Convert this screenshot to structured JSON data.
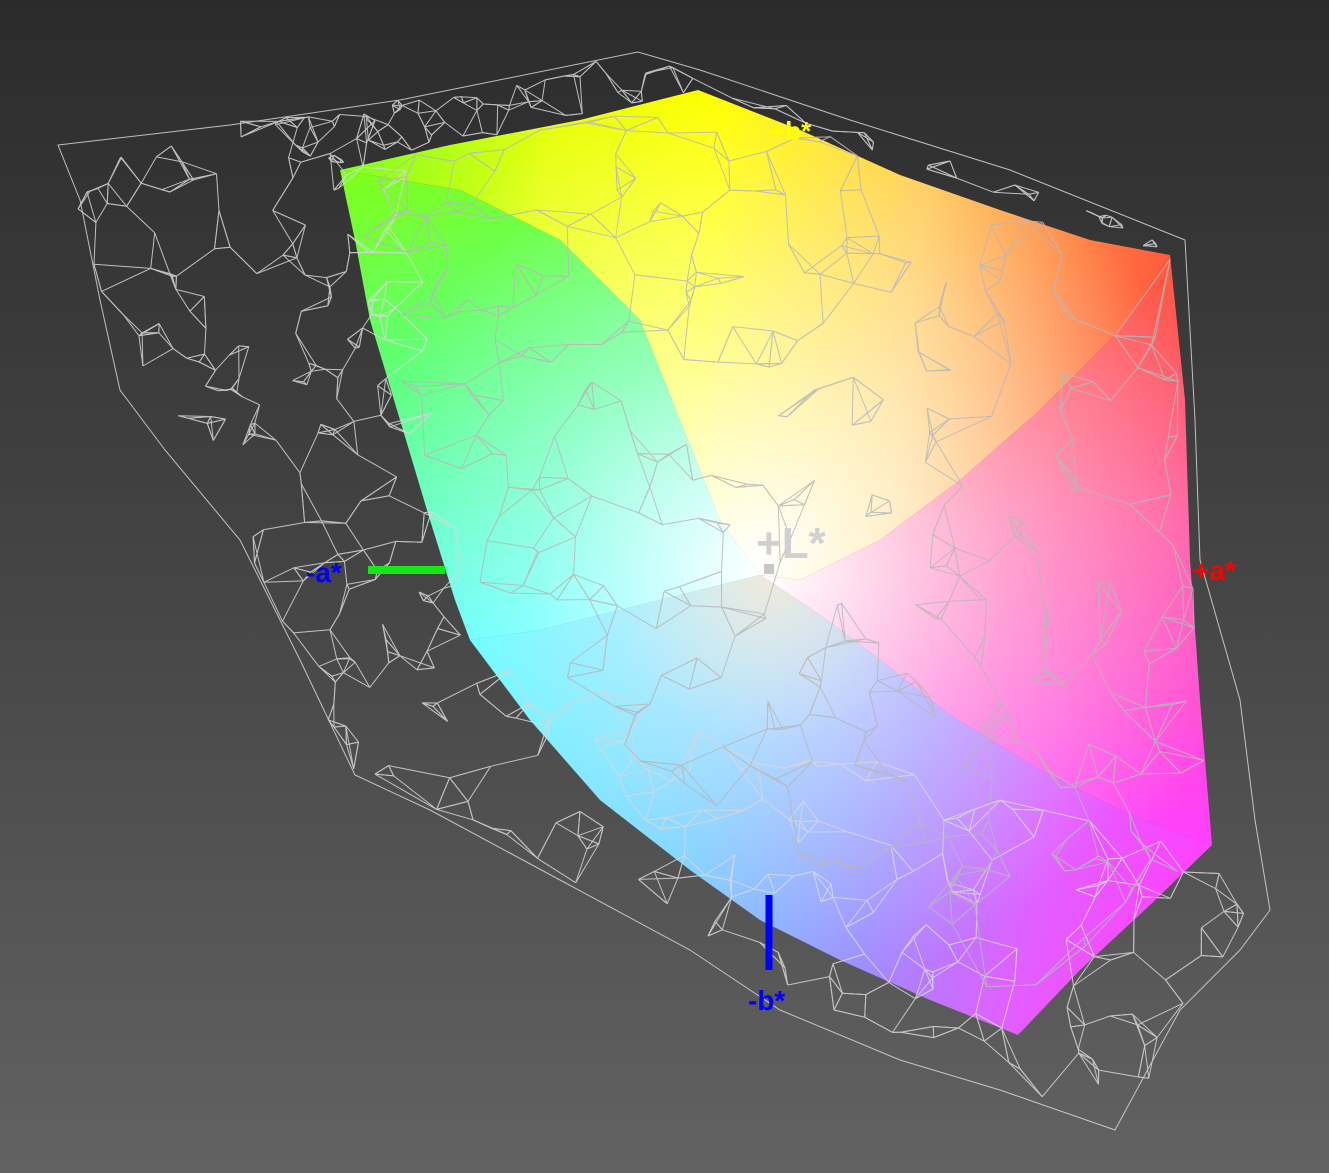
{
  "viewer": {
    "background_top": "#2b2b2b",
    "background_bottom": "#626262",
    "wireframe_color": "#d8d8d8"
  },
  "axes": {
    "plus_L": {
      "label": "+L*",
      "color": "#d0d0d0"
    },
    "plus_a": {
      "label": "+a*",
      "color": "#ff0000"
    },
    "minus_a": {
      "label": "-a*",
      "color": "#0000ff",
      "line_color": "#19e619"
    },
    "minus_b": {
      "label": "-b*",
      "color": "#0000ff",
      "line_color": "#0000ff"
    },
    "plus_b": {
      "label": "+b*",
      "color": "#ffff00"
    }
  },
  "solid_colors": {
    "green": "#7dff1e",
    "yellow": "#ffff00",
    "orange": "#ffa64d",
    "red": "#ff5a3c",
    "magenta": "#ff40ff",
    "violet": "#9a66ff",
    "blue": "#66a8ff",
    "cyan": "#4dffff",
    "white": "#ffffff"
  }
}
